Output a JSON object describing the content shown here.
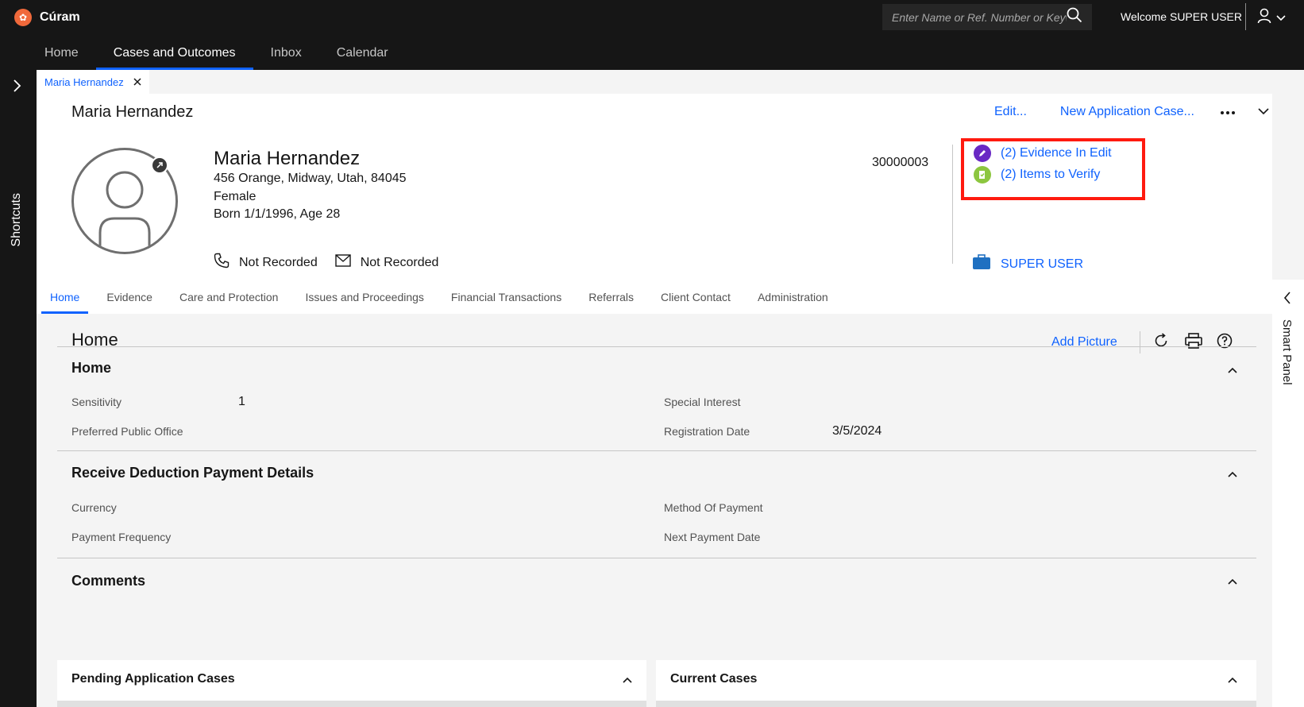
{
  "app": {
    "name": "Cúram"
  },
  "search": {
    "placeholder": "Enter Name or Ref. Number or Keyw"
  },
  "welcome": "Welcome SUPER USER",
  "nav": [
    {
      "label": "Home"
    },
    {
      "label": "Cases and Outcomes",
      "active": true
    },
    {
      "label": "Inbox"
    },
    {
      "label": "Calendar"
    }
  ],
  "shortcuts_label": "Shortcuts",
  "open_tab": {
    "label": "Maria Hernandez"
  },
  "header": {
    "title": "Maria Hernandez",
    "edit_label": "Edit...",
    "new_app_label": "New Application Case..."
  },
  "person": {
    "name": "Maria Hernandez",
    "address": "456 Orange, Midway, Utah, 84045",
    "gender": "Female",
    "born": "Born 1/1/1996, Age 28",
    "phone": "Not Recorded",
    "email": "Not Recorded",
    "reference": "30000003"
  },
  "indicators": [
    {
      "label": "(2) Evidence In Edit",
      "color": "#6929c4"
    },
    {
      "label": "(2) Items to Verify",
      "color": "#8cc63f"
    }
  ],
  "owner": "SUPER USER",
  "section_tabs": [
    {
      "label": "Home",
      "active": true
    },
    {
      "label": "Evidence"
    },
    {
      "label": "Care and Protection"
    },
    {
      "label": "Issues and Proceedings"
    },
    {
      "label": "Financial Transactions"
    },
    {
      "label": "Referrals"
    },
    {
      "label": "Client Contact"
    },
    {
      "label": "Administration"
    }
  ],
  "smart_panel_label": "Smart Panel",
  "content": {
    "title": "Home",
    "add_picture_label": "Add Picture",
    "sections": {
      "home": {
        "title": "Home",
        "sensitivity_label": "Sensitivity",
        "sensitivity_value": "1",
        "preferred_office_label": "Preferred Public Office",
        "special_interest_label": "Special Interest",
        "registration_label": "Registration Date",
        "registration_value": "3/5/2024"
      },
      "payment": {
        "title": "Receive Deduction Payment Details",
        "currency_label": "Currency",
        "frequency_label": "Payment Frequency",
        "method_label": "Method Of Payment",
        "next_date_label": "Next Payment Date"
      },
      "comments": {
        "title": "Comments"
      }
    },
    "panels": {
      "pending": "Pending Application Cases",
      "current": "Current Cases"
    }
  },
  "colors": {
    "accent": "#0f62fe",
    "highlight": "#ff1a0f",
    "topbar": "#161616"
  }
}
